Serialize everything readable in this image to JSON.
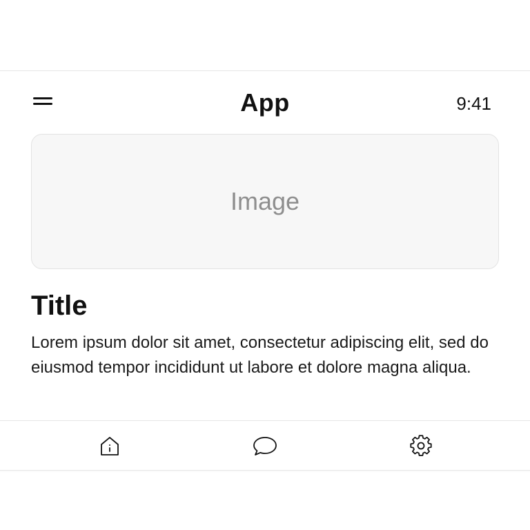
{
  "header": {
    "title": "App",
    "time": "9:41",
    "menu_icon": "hamburger-menu-icon"
  },
  "media": {
    "placeholder_label": "Image"
  },
  "content": {
    "title": "Title",
    "body": "Lorem ipsum dolor sit amet, consectetur adipiscing elit, sed do eiusmod tempor incididunt ut labore et dolore magna aliqua."
  },
  "tab_bar": {
    "tabs": [
      {
        "icon": "home-icon"
      },
      {
        "icon": "chat-bubble-icon"
      },
      {
        "icon": "gear-icon"
      }
    ]
  },
  "colors": {
    "text": "#111111",
    "placeholder_text": "#8e8e8e",
    "placeholder_bg": "#f7f7f7",
    "border": "#e6e6e6"
  }
}
